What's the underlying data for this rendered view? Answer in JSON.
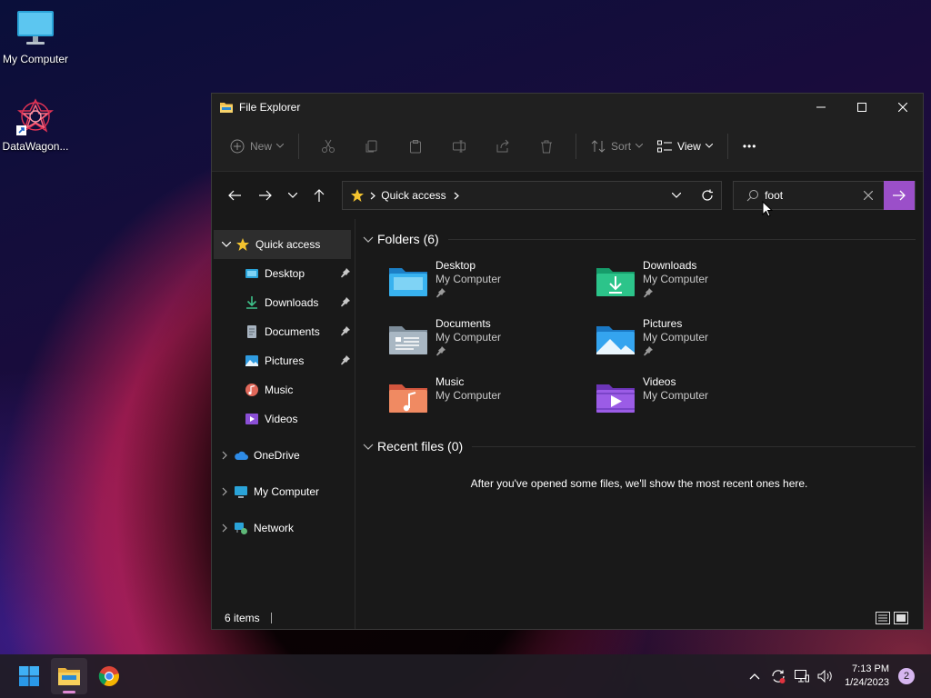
{
  "desktop": {
    "icons": [
      {
        "label": "My Computer",
        "icon": "monitor-icon"
      },
      {
        "label": "DataWagon...",
        "icon": "datawagon-logo-icon"
      }
    ]
  },
  "window": {
    "title": "File Explorer",
    "toolbar": {
      "new_label": "New",
      "sort_label": "Sort",
      "view_label": "View",
      "more_glyph": "•••"
    },
    "address": {
      "location": "Quick access"
    },
    "search": {
      "value": "foot"
    },
    "sidebar": {
      "quick_access": "Quick access",
      "items": [
        {
          "label": "Desktop",
          "icon": "desktop-folder-icon",
          "pinned": true
        },
        {
          "label": "Downloads",
          "icon": "download-icon",
          "pinned": true
        },
        {
          "label": "Documents",
          "icon": "documents-icon",
          "pinned": true
        },
        {
          "label": "Pictures",
          "icon": "pictures-icon",
          "pinned": true
        },
        {
          "label": "Music",
          "icon": "music-icon",
          "pinned": false
        },
        {
          "label": "Videos",
          "icon": "videos-icon",
          "pinned": false
        }
      ],
      "onedrive": "OneDrive",
      "my_computer": "My Computer",
      "network": "Network"
    },
    "content": {
      "folders_header": "Folders (6)",
      "folders": [
        {
          "name": "Desktop",
          "location": "My Computer",
          "pinned": true
        },
        {
          "name": "Downloads",
          "location": "My Computer",
          "pinned": true
        },
        {
          "name": "Documents",
          "location": "My Computer",
          "pinned": true
        },
        {
          "name": "Pictures",
          "location": "My Computer",
          "pinned": true
        },
        {
          "name": "Music",
          "location": "My Computer",
          "pinned": false
        },
        {
          "name": "Videos",
          "location": "My Computer",
          "pinned": false
        }
      ],
      "recent_header": "Recent files (0)",
      "recent_empty": "After you've opened some files, we'll show the most recent ones here."
    },
    "status": {
      "items_count": "6 items"
    }
  },
  "taskbar": {
    "time": "7:13 PM",
    "date": "1/24/2023",
    "notifications": "2"
  },
  "colors": {
    "accent": "#9b4fc9",
    "window_bg": "#191919",
    "toolbar_bg": "#202020"
  }
}
